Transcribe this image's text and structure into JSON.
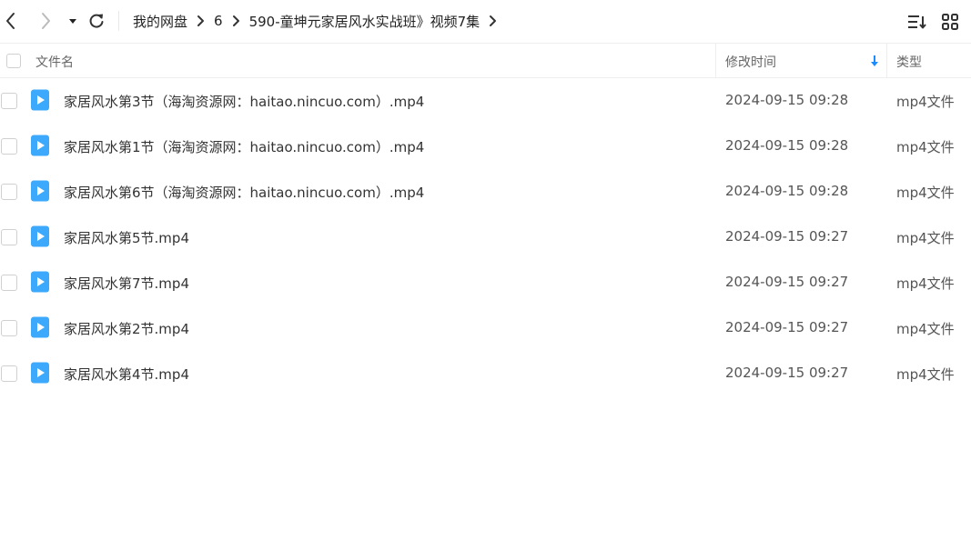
{
  "breadcrumb": {
    "items": [
      "我的网盘",
      "6",
      "590-童坤元家居风水实战班》视频7集"
    ]
  },
  "header": {
    "name_label": "文件名",
    "mtime_label": "修改时间",
    "type_label": "类型"
  },
  "files": [
    {
      "name": "家居风水第3节（海淘资源网：haitao.nincuo.com）.mp4",
      "time": "2024-09-15 09:28",
      "type": "mp4文件"
    },
    {
      "name": "家居风水第1节（海淘资源网：haitao.nincuo.com）.mp4",
      "time": "2024-09-15 09:28",
      "type": "mp4文件"
    },
    {
      "name": "家居风水第6节（海淘资源网：haitao.nincuo.com）.mp4",
      "time": "2024-09-15 09:28",
      "type": "mp4文件"
    },
    {
      "name": "家居风水第5节.mp4",
      "time": "2024-09-15 09:27",
      "type": "mp4文件"
    },
    {
      "name": "家居风水第7节.mp4",
      "time": "2024-09-15 09:27",
      "type": "mp4文件"
    },
    {
      "name": "家居风水第2节.mp4",
      "time": "2024-09-15 09:27",
      "type": "mp4文件"
    },
    {
      "name": "家居风水第4节.mp4",
      "time": "2024-09-15 09:27",
      "type": "mp4文件"
    }
  ],
  "icons": {
    "back": "chevron-left-icon",
    "forward": "chevron-right-icon",
    "history": "caret-down-icon",
    "refresh": "refresh-icon",
    "sort": "sort-list-icon",
    "view": "grid-view-icon",
    "file": "video-file-icon"
  },
  "colors": {
    "accent": "#1a8cff",
    "video_icon": "#3da9fc"
  }
}
